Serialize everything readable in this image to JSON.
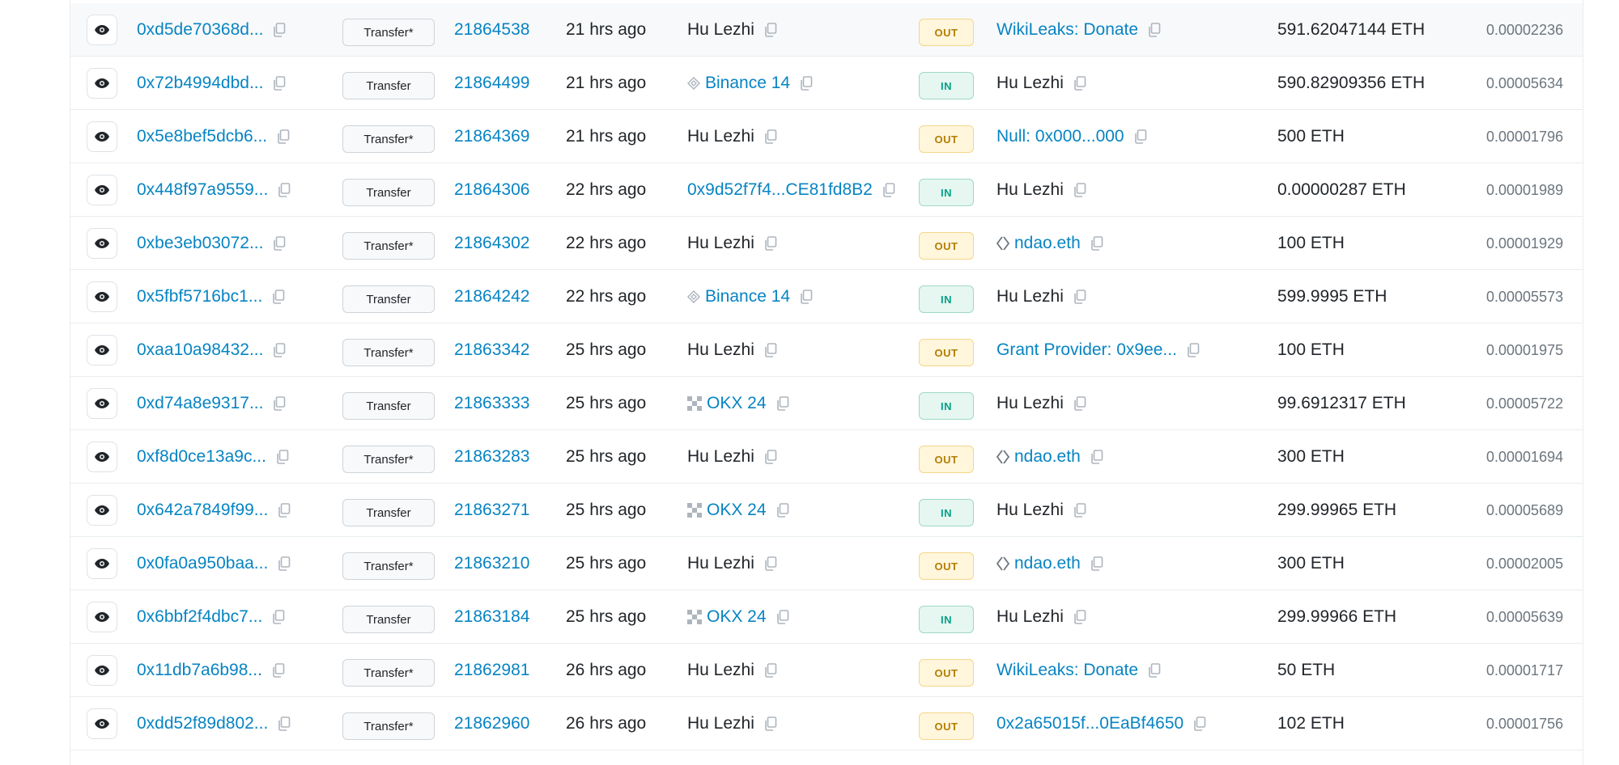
{
  "colors": {
    "link": "#0784c3",
    "out_bg": "#fff6dc",
    "out_text": "#b47d00",
    "in_bg": "#e6f6f1",
    "in_text": "#00a186"
  },
  "icons": {
    "view": "eye-icon",
    "copy": "copy-icon",
    "binance": "binance-icon",
    "okx": "okx-icon",
    "ens": "ens-icon"
  },
  "rows": [
    {
      "hash": "0xd5de70368d...",
      "method": "Transfer*",
      "block": "21864538",
      "age": "21 hrs ago",
      "from": "Hu Lezhi",
      "from_link": false,
      "from_icon": "",
      "dir": "OUT",
      "to": "WikiLeaks: Donate",
      "to_link": true,
      "to_icon": "",
      "value": "591.62047144 ETH",
      "fee": "0.00002236"
    },
    {
      "hash": "0x72b4994dbd...",
      "method": "Transfer",
      "block": "21864499",
      "age": "21 hrs ago",
      "from": "Binance 14",
      "from_link": true,
      "from_icon": "binance",
      "dir": "IN",
      "to": "Hu Lezhi",
      "to_link": false,
      "to_icon": "",
      "value": "590.82909356 ETH",
      "fee": "0.00005634"
    },
    {
      "hash": "0x5e8bef5dcb6...",
      "method": "Transfer*",
      "block": "21864369",
      "age": "21 hrs ago",
      "from": "Hu Lezhi",
      "from_link": false,
      "from_icon": "",
      "dir": "OUT",
      "to": "Null: 0x000...000",
      "to_link": true,
      "to_icon": "",
      "value": "500 ETH",
      "fee": "0.00001796"
    },
    {
      "hash": "0x448f97a9559...",
      "method": "Transfer",
      "block": "21864306",
      "age": "22 hrs ago",
      "from": "0x9d52f7f4...CE81fd8B2",
      "from_link": true,
      "from_icon": "",
      "dir": "IN",
      "to": "Hu Lezhi",
      "to_link": false,
      "to_icon": "",
      "value": "0.00000287 ETH",
      "fee": "0.00001989"
    },
    {
      "hash": "0xbe3eb03072...",
      "method": "Transfer*",
      "block": "21864302",
      "age": "22 hrs ago",
      "from": "Hu Lezhi",
      "from_link": false,
      "from_icon": "",
      "dir": "OUT",
      "to": "ndao.eth",
      "to_link": true,
      "to_icon": "ens",
      "value": "100 ETH",
      "fee": "0.00001929"
    },
    {
      "hash": "0x5fbf5716bc1...",
      "method": "Transfer",
      "block": "21864242",
      "age": "22 hrs ago",
      "from": "Binance 14",
      "from_link": true,
      "from_icon": "binance",
      "dir": "IN",
      "to": "Hu Lezhi",
      "to_link": false,
      "to_icon": "",
      "value": "599.9995 ETH",
      "fee": "0.00005573"
    },
    {
      "hash": "0xaa10a98432...",
      "method": "Transfer*",
      "block": "21863342",
      "age": "25 hrs ago",
      "from": "Hu Lezhi",
      "from_link": false,
      "from_icon": "",
      "dir": "OUT",
      "to": "Grant Provider: 0x9ee...",
      "to_link": true,
      "to_icon": "",
      "value": "100 ETH",
      "fee": "0.00001975"
    },
    {
      "hash": "0xd74a8e9317...",
      "method": "Transfer",
      "block": "21863333",
      "age": "25 hrs ago",
      "from": "OKX 24",
      "from_link": true,
      "from_icon": "okx",
      "dir": "IN",
      "to": "Hu Lezhi",
      "to_link": false,
      "to_icon": "",
      "value": "99.6912317 ETH",
      "fee": "0.00005722"
    },
    {
      "hash": "0xf8d0ce13a9c...",
      "method": "Transfer*",
      "block": "21863283",
      "age": "25 hrs ago",
      "from": "Hu Lezhi",
      "from_link": false,
      "from_icon": "",
      "dir": "OUT",
      "to": "ndao.eth",
      "to_link": true,
      "to_icon": "ens",
      "value": "300 ETH",
      "fee": "0.00001694"
    },
    {
      "hash": "0x642a7849f99...",
      "method": "Transfer",
      "block": "21863271",
      "age": "25 hrs ago",
      "from": "OKX 24",
      "from_link": true,
      "from_icon": "okx",
      "dir": "IN",
      "to": "Hu Lezhi",
      "to_link": false,
      "to_icon": "",
      "value": "299.99965 ETH",
      "fee": "0.00005689"
    },
    {
      "hash": "0x0fa0a950baa...",
      "method": "Transfer*",
      "block": "21863210",
      "age": "25 hrs ago",
      "from": "Hu Lezhi",
      "from_link": false,
      "from_icon": "",
      "dir": "OUT",
      "to": "ndao.eth",
      "to_link": true,
      "to_icon": "ens",
      "value": "300 ETH",
      "fee": "0.00002005"
    },
    {
      "hash": "0x6bbf2f4dbc7...",
      "method": "Transfer",
      "block": "21863184",
      "age": "25 hrs ago",
      "from": "OKX 24",
      "from_link": true,
      "from_icon": "okx",
      "dir": "IN",
      "to": "Hu Lezhi",
      "to_link": false,
      "to_icon": "",
      "value": "299.99966 ETH",
      "fee": "0.00005639"
    },
    {
      "hash": "0x11db7a6b98...",
      "method": "Transfer*",
      "block": "21862981",
      "age": "26 hrs ago",
      "from": "Hu Lezhi",
      "from_link": false,
      "from_icon": "",
      "dir": "OUT",
      "to": "WikiLeaks: Donate",
      "to_link": true,
      "to_icon": "",
      "value": "50 ETH",
      "fee": "0.00001717"
    },
    {
      "hash": "0xdd52f89d802...",
      "method": "Transfer*",
      "block": "21862960",
      "age": "26 hrs ago",
      "from": "Hu Lezhi",
      "from_link": false,
      "from_icon": "",
      "dir": "OUT",
      "to": "0x2a65015f...0EaBf4650",
      "to_link": true,
      "to_icon": "",
      "value": "102 ETH",
      "fee": "0.00001756"
    }
  ]
}
